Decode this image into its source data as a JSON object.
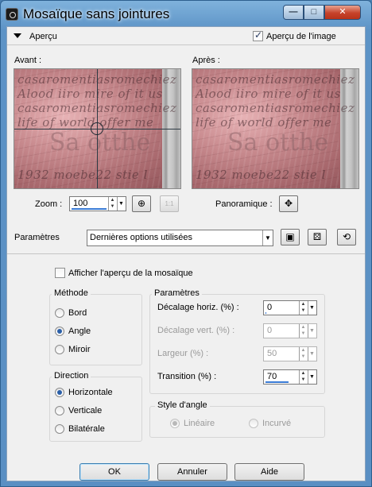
{
  "window": {
    "title": "Mosaïque sans jointures",
    "buttons": {
      "minimize": "—",
      "maximize": "□",
      "close": "✕"
    }
  },
  "preview_section": {
    "toggle_label": "Aperçu",
    "show_image_preview_label": "Aperçu de l'image",
    "show_image_preview_checked": true,
    "before_label": "Avant :",
    "after_label": "Après :",
    "preview_text_lines": [
      "casaromentiasromechiez",
      "Alood iiro mire of it us",
      "casaromentiasromechiez",
      "life of world offer me"
    ],
    "preview_big_text": "Sa otthe",
    "preview_bottom_text": "1932 moebe22 stie l",
    "zoom_label": "Zoom :",
    "zoom_value": "100",
    "zoom_actual_size_label": "1:1",
    "pan_label": "Panoramique :"
  },
  "presets": {
    "label": "Paramètres",
    "selected": "Dernières options utilisées"
  },
  "options": {
    "show_mosaic_preview_label": "Afficher l'aperçu de la mosaïque",
    "show_mosaic_preview_checked": false,
    "method": {
      "title": "Méthode",
      "items": [
        {
          "label": "Bord",
          "selected": false
        },
        {
          "label": "Angle",
          "selected": true
        },
        {
          "label": "Miroir",
          "selected": false
        }
      ]
    },
    "direction": {
      "title": "Direction",
      "items": [
        {
          "label": "Horizontale",
          "selected": true
        },
        {
          "label": "Verticale",
          "selected": false
        },
        {
          "label": "Bilatérale",
          "selected": false
        }
      ]
    },
    "parameters": {
      "title": "Paramètres",
      "fields": [
        {
          "label": "Décalage horiz. (%) :",
          "value": "0",
          "enabled": true,
          "fill": 0.0
        },
        {
          "label": "Décalage vert. (%) :",
          "value": "0",
          "enabled": false,
          "fill": 0.0
        },
        {
          "label": "Largeur (%) :",
          "value": "50",
          "enabled": false,
          "fill": 0.5
        },
        {
          "label": "Transition (%) :",
          "value": "70",
          "enabled": true,
          "fill": 0.7
        }
      ]
    },
    "corner_style": {
      "title": "Style d'angle",
      "items": [
        {
          "label": "Linéaire",
          "selected": true
        },
        {
          "label": "Incurvé",
          "selected": false
        }
      ]
    }
  },
  "footer": {
    "ok_label": "OK",
    "cancel_label": "Annuler",
    "help_label": "Aide"
  },
  "colors": {
    "title_bar": "#5d93c6",
    "close_button": "#c6432b",
    "preview_tone": "#c88a8e",
    "accent": "#2a5fa8"
  }
}
